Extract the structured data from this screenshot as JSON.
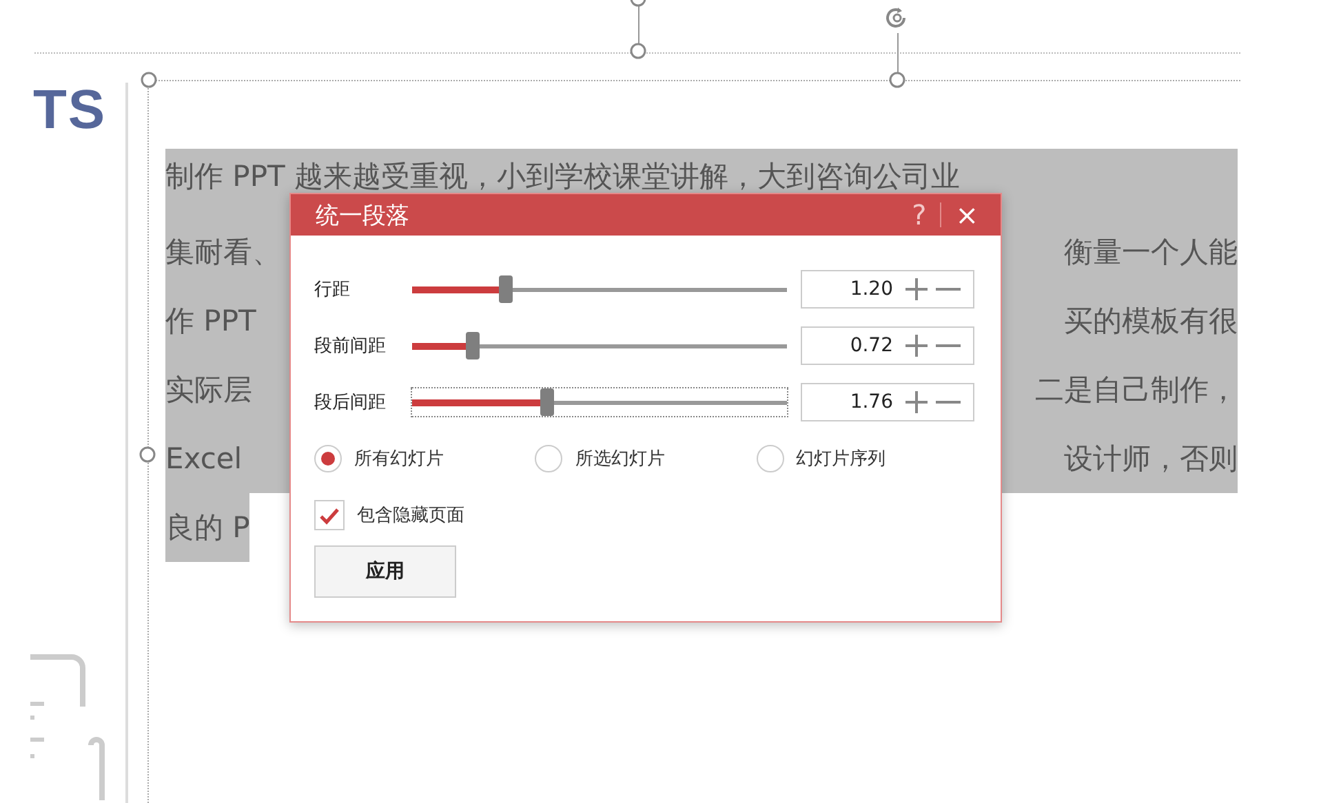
{
  "slide": {
    "title_fragment": "TS",
    "text_lines": [
      {
        "left": "制作 PPT 越来越受重视，小到学校课堂讲解，大到咨询公司业"
      },
      {
        "left": "集耐看、",
        "right": "衡量一个人能"
      },
      {
        "left": "作 PPT",
        "right": "买的模板有很"
      },
      {
        "left": "实际层",
        "right": "二是自己制作，"
      },
      {
        "left": "Excel",
        "right": "设计师，否则"
      },
      {
        "left": "良的 P"
      }
    ]
  },
  "dialog": {
    "title": "统一段落",
    "help": "?",
    "close": "×",
    "spacing": [
      {
        "label": "行距",
        "level": 0.25,
        "value": "1.20",
        "focused": false
      },
      {
        "label": "段前间距",
        "level": 0.16,
        "value": "0.72",
        "focused": false
      },
      {
        "label": "段后间距",
        "level": 0.36,
        "value": "1.76",
        "focused": true
      }
    ],
    "scope": [
      {
        "label": "所有幻灯片",
        "selected": true
      },
      {
        "label": "所选幻灯片",
        "selected": false
      },
      {
        "label": "幻灯片序列",
        "selected": false
      }
    ],
    "include_hidden": {
      "label": "包含隐藏页面",
      "checked": true
    },
    "apply_button": "应用"
  }
}
